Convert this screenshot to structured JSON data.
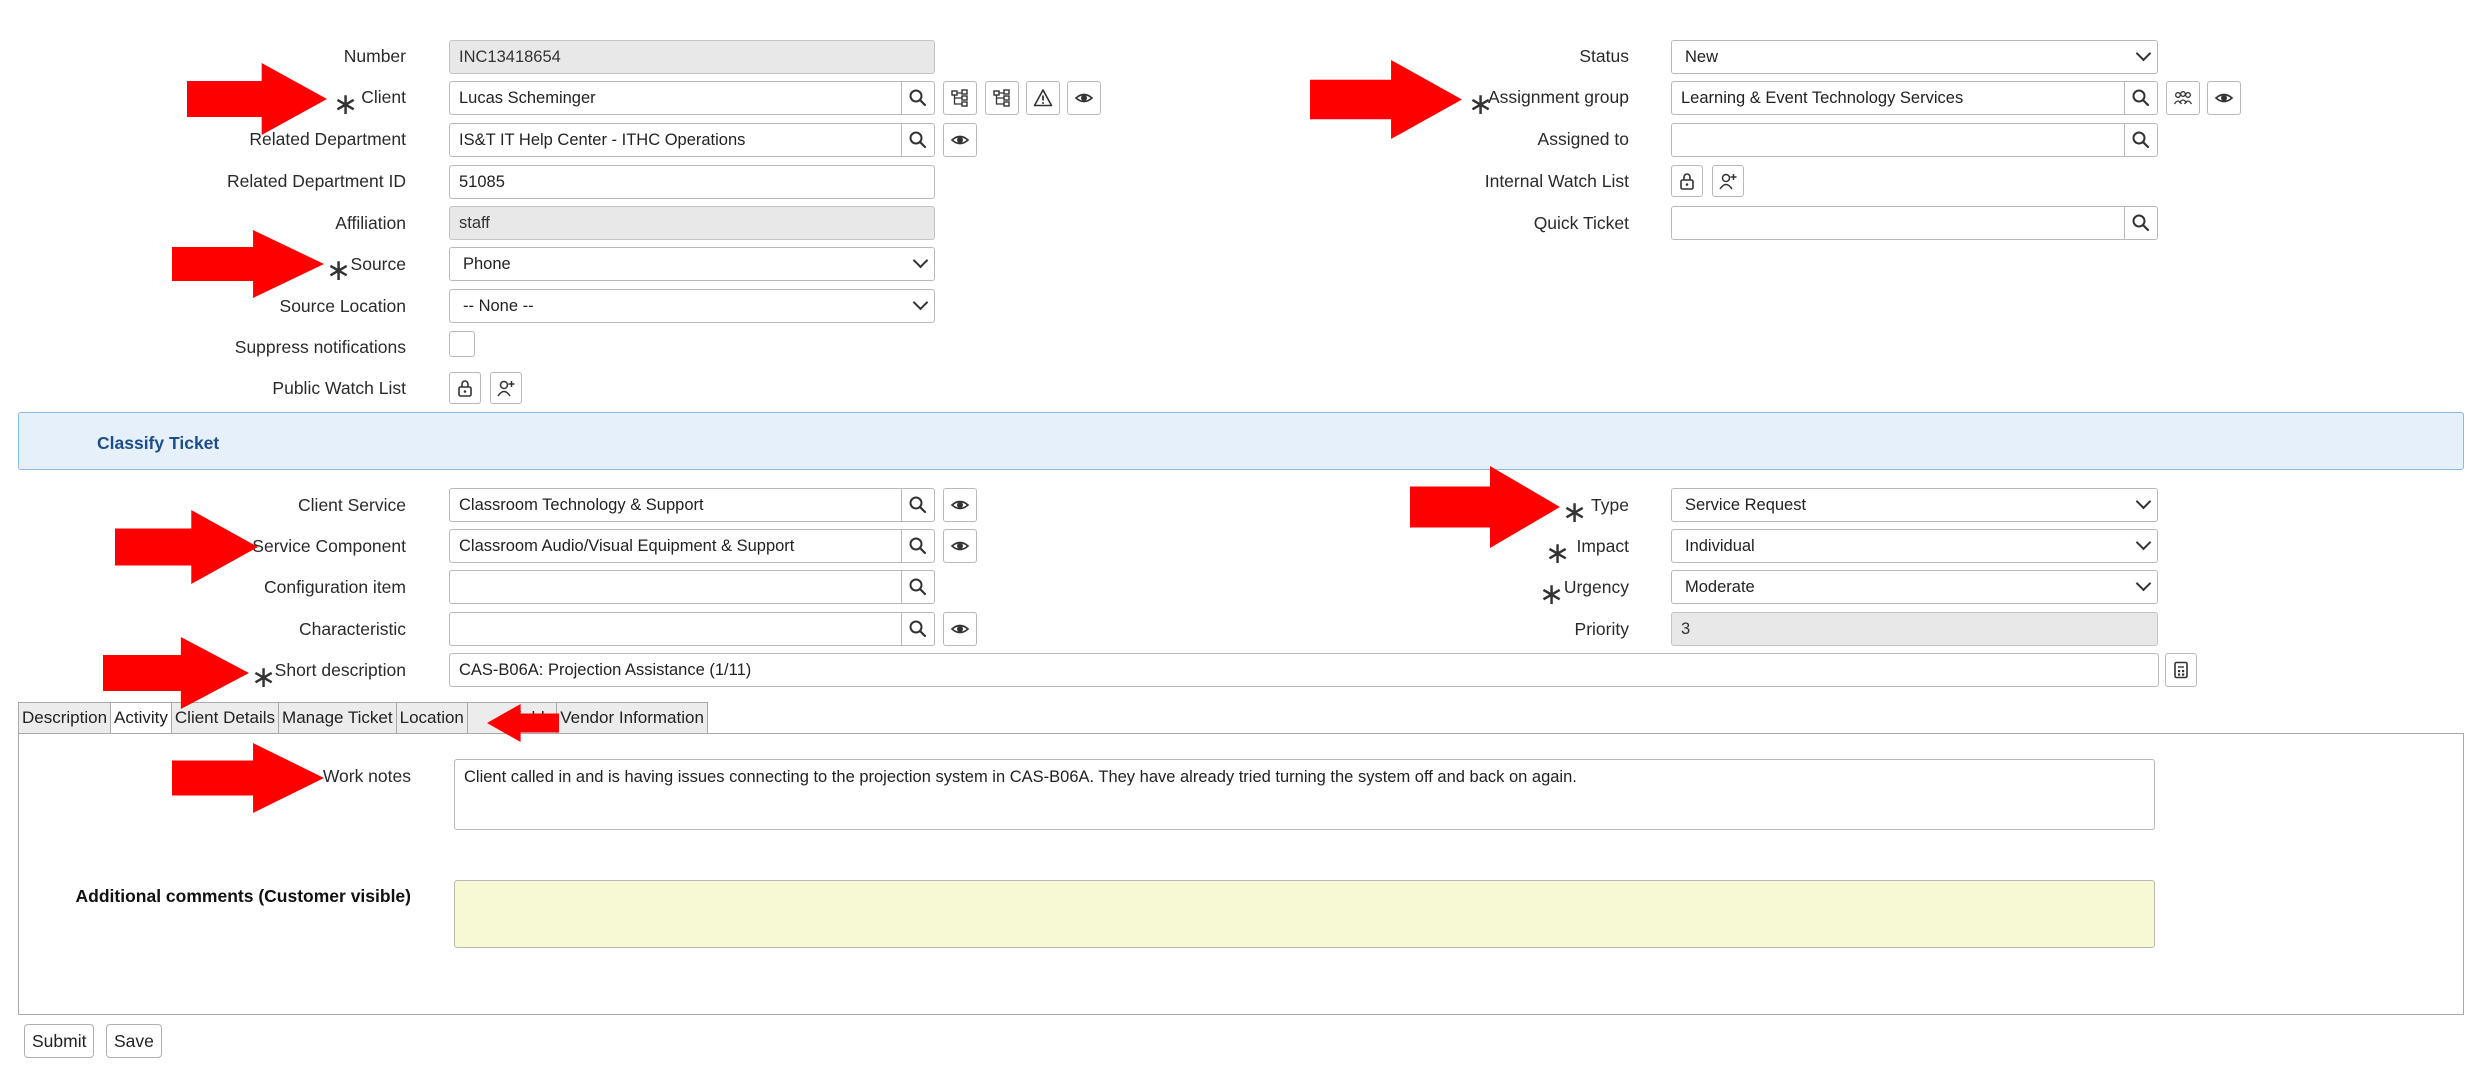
{
  "left_fields": {
    "number": {
      "label": "Number",
      "value": "INC13418654"
    },
    "client": {
      "label": "Client",
      "value": "Lucas Scheminger"
    },
    "related_department": {
      "label": "Related Department",
      "value": "IS&T IT Help Center - ITHC Operations"
    },
    "related_department_id": {
      "label": "Related Department ID",
      "value": "51085"
    },
    "affiliation": {
      "label": "Affiliation",
      "value": "staff"
    },
    "source": {
      "label": "Source",
      "value": "Phone"
    },
    "source_location": {
      "label": "Source Location",
      "value": "-- None --"
    },
    "suppress_notifications": {
      "label": "Suppress notifications"
    },
    "public_watch_list": {
      "label": "Public Watch List"
    }
  },
  "right_fields": {
    "status": {
      "label": "Status",
      "value": "New"
    },
    "assignment_group": {
      "label": "Assignment group",
      "value": "Learning & Event Technology Services"
    },
    "assigned_to": {
      "label": "Assigned to",
      "value": ""
    },
    "internal_watch_list": {
      "label": "Internal Watch List"
    },
    "quick_ticket": {
      "label": "Quick Ticket",
      "value": ""
    }
  },
  "section": {
    "title": "Classify Ticket"
  },
  "classify": {
    "client_service": {
      "label": "Client Service",
      "value": "Classroom Technology & Support"
    },
    "service_component": {
      "label": "Service Component",
      "value": "Classroom Audio/Visual Equipment & Support"
    },
    "configuration_item": {
      "label": "Configuration item",
      "value": ""
    },
    "characteristic": {
      "label": "Characteristic",
      "value": ""
    },
    "short_description": {
      "label": "Short description",
      "value": "CAS-B06A: Projection Assistance (1/11)"
    },
    "type": {
      "label": "Type",
      "value": "Service Request"
    },
    "impact": {
      "label": "Impact",
      "value": "Individual"
    },
    "urgency": {
      "label": "Urgency",
      "value": "Moderate"
    },
    "priority": {
      "label": "Priority",
      "value": "3"
    }
  },
  "tabs": [
    "Description",
    "Activity",
    "Client Details",
    "Manage Ticket",
    "Location",
    "Fields",
    "Vendor Information"
  ],
  "activity": {
    "work_notes": {
      "label": "Work notes",
      "value": "Client called in and is having issues connecting to the projection system in CAS-B06A. They have already tried turning the system off and back on again."
    },
    "additional_comments": {
      "label": "Additional comments (Customer visible)",
      "value": ""
    }
  },
  "buttons": {
    "submit": "Submit",
    "save": "Save"
  },
  "required_marker": "∗",
  "colors": {
    "annotation_arrow": "#ff0000",
    "section_bg": "#e6f0fa",
    "comments_bg": "#f7f8d4",
    "readonly_bg": "#e8e8e8"
  },
  "icons": [
    "search-icon",
    "reference-tree-icon",
    "alert-icon",
    "eye-icon",
    "lock-icon",
    "add-person-icon",
    "group-icon",
    "template-icon"
  ]
}
